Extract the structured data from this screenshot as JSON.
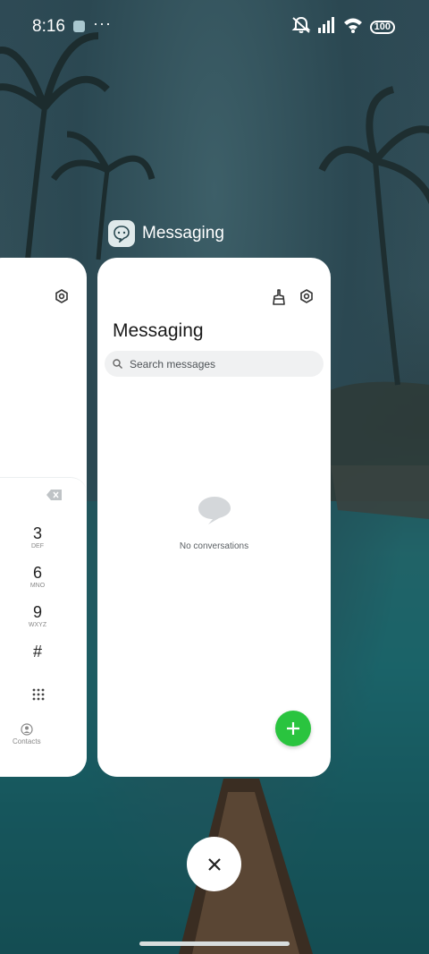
{
  "status_bar": {
    "time": "8:16",
    "overflow": "···",
    "battery": "100",
    "icons": [
      "mute-icon",
      "signal-icon",
      "wifi-icon",
      "battery-icon"
    ]
  },
  "recents": {
    "focused_app_label": "Messaging",
    "left_card": {
      "app": "Phone",
      "keys": [
        {
          "num": "3",
          "letters": "DEF"
        },
        {
          "num": "6",
          "letters": "MNO"
        },
        {
          "num": "9",
          "letters": "WXYZ"
        },
        {
          "num": "#",
          "letters": ""
        }
      ],
      "contacts_label": "Contacts"
    },
    "main_card": {
      "title": "Messaging",
      "search_placeholder": "Search messages",
      "empty_text": "No conversations"
    }
  },
  "colors": {
    "fab": "#2ac43f",
    "card": "#ffffff"
  }
}
